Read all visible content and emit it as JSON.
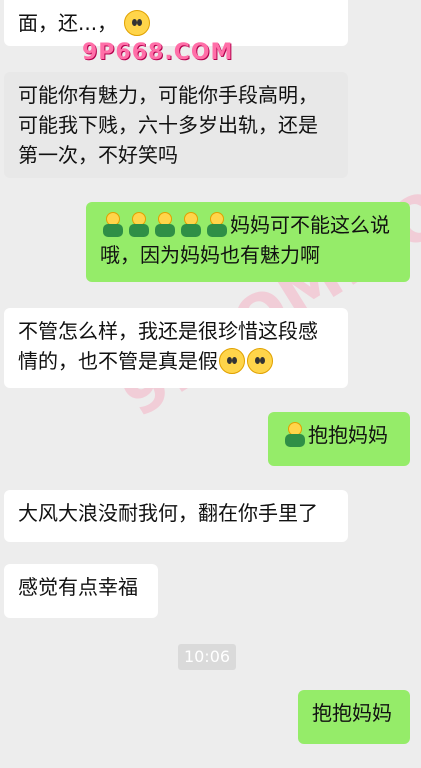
{
  "messages": [
    {
      "text": "面，还...，"
    },
    {
      "text": "可能你有魅力，可能你手段高明，可能我下贱，六十多岁出轨，还是第一次，不好笑吗"
    },
    {
      "text": "妈妈可不能这么说哦，因为妈妈也有魅力啊"
    },
    {
      "text": "不管怎么样，我还是很珍惜这段感情的，也不管是真是假"
    },
    {
      "text": "抱抱妈妈"
    },
    {
      "text": "大风大浪没耐我何，翻在你手里了"
    },
    {
      "text": "感觉有点幸福"
    },
    {
      "text": "抱抱妈妈"
    }
  ],
  "timestamp": "10:06",
  "watermark": {
    "primary": "9P668.COM",
    "secondary": "91POM.COM"
  },
  "icons": {
    "smile": "smile-emoji-icon",
    "hug": "hug-emoji-icon"
  },
  "colors": {
    "background": "#ededed",
    "incoming_bubble": "#ffffff",
    "outgoing_bubble": "#95ec69"
  }
}
